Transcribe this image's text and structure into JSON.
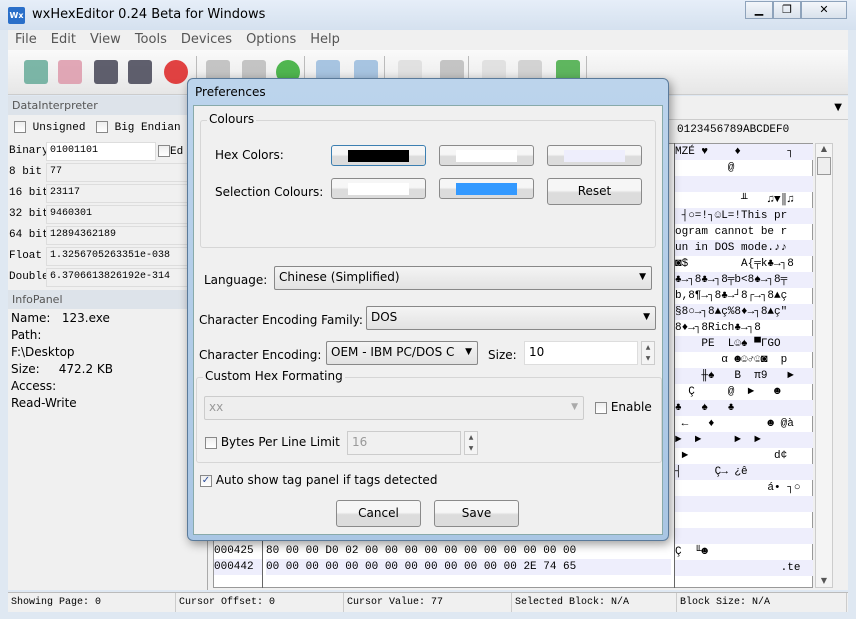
{
  "window": {
    "title": "wxHexEditor 0.24 Beta for Windows",
    "logo": "Wx",
    "controls": [
      "minimize-icon",
      "restore-icon",
      "close-icon"
    ]
  },
  "menu": [
    "File",
    "Edit",
    "View",
    "Tools",
    "Devices",
    "Options",
    "Help"
  ],
  "toolbar": [
    "new-file-icon",
    "open-file-icon",
    "save-icon",
    "save-as-icon",
    "close-file-icon",
    "find-icon",
    "replace-icon",
    "goto-icon",
    "undo-icon",
    "redo-icon",
    "copy-icon",
    "paste-icon",
    "cut-icon",
    "delete-icon",
    "insert-icon"
  ],
  "data_interpreter": {
    "title": "DataInterpreter",
    "unsigned": "Unsigned",
    "big_endian": "Big Endian",
    "edit": "Ed",
    "rows": [
      {
        "label": "Binary",
        "value": "01001101"
      },
      {
        "label": "8 bit",
        "value": "77"
      },
      {
        "label": "16 bit",
        "value": "23117"
      },
      {
        "label": "32 bit",
        "value": "9460301"
      },
      {
        "label": "64 bit",
        "value": "12894362189"
      },
      {
        "label": "Float",
        "value": "1.3256705263351e-038"
      },
      {
        "label": "Double",
        "value": "6.3706613826192e-314"
      }
    ]
  },
  "info_panel": {
    "title": "InfoPanel",
    "lines": [
      "Name:   123.exe",
      "Path:",
      "F:\\Desktop",
      "Size:     472.2 KB",
      "Access:",
      "Read-Write"
    ]
  },
  "hex": {
    "text_header": "0123456789ABCDEF0",
    "rows": [
      {
        "offset": "000425",
        "bytes": "80 00 00 D0 02 00 00 00 00 00 00 00 00 00 00 00"
      },
      {
        "offset": "000442",
        "bytes": "00 00 00 00 00 00 00 00 00 00 00 00 00 2E 74 65"
      }
    ],
    "text_rows": [
      "MZÉ ♥    ♦       ┐",
      "        @",
      "",
      "          ╨   ♫▼║♫",
      " ┤○=!┐☺L=!This pr",
      "ogram cannot be r",
      "un in DOS mode.♪♪",
      "◙$        A{╤k♣→┐8",
      "♣→┐8♣→┐8╤b<8♠→┐8╤",
      "b,8¶→┐8♣→┘8┌→┐8▲ç",
      "§8○→┐8▲ç%8♦→┐8▲ç\"",
      "8♦→┐8Rich♣→┐8",
      "    PE  L☺♠ ▀ΓGO",
      "       α ☻☺♂☺◙  p",
      "    ╫♠   B  π9   ►",
      "  Ç     @  ►   ☻",
      "♣   ♠   ♣",
      " ←   ♦        ☻ @à",
      "►  ►     ►  ►",
      " ►             d¢",
      "┤     Ç→ ¿ê",
      "              á• ┐○",
      "",
      "",
      "",
      "Ç  ╙☻",
      "                .te"
    ]
  },
  "status": [
    "Showing Page: 0",
    "Cursor Offset: 0",
    "Cursor Value: 77",
    "Selected Block: N/A",
    "Block Size: N/A"
  ],
  "dialog": {
    "title": "Preferences",
    "colours_group": "Colours",
    "hex_colors_label": "Hex Colors:",
    "selection_colours_label": "Selection Colours:",
    "hex_colors": [
      "#000000",
      "#ffffff",
      "#eeeefc"
    ],
    "selection_colors": [
      "#ffffff",
      "#3399ff"
    ],
    "reset": "Reset",
    "language_label": "Language:",
    "language": "Chinese (Simplified)",
    "encoding_family_label": "Character Encoding Family:",
    "encoding_family": "DOS",
    "encoding_label": "Character Encoding:",
    "encoding": "OEM - IBM PC/DOS C",
    "size_label": "Size:",
    "size": "10",
    "custom_group": "Custom Hex Formating",
    "custom_format": "xx",
    "enable": "Enable",
    "enable_checked": false,
    "bytes_per_line": "Bytes Per Line Limit",
    "bytes_per_line_checked": false,
    "bytes_per_line_value": "16",
    "auto_show": "Auto show tag panel if tags detected",
    "auto_show_checked": true,
    "cancel": "Cancel",
    "save": "Save"
  }
}
